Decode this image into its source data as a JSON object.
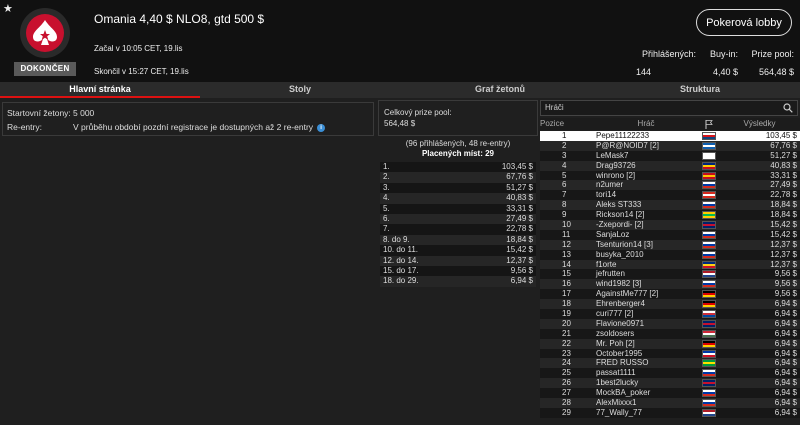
{
  "header": {
    "title": "Omania 4,40 $ NLO8, gtd 500 $",
    "started": "Začal v 10:05 CET, 19.lis",
    "ended": "Skončil v 15:27 CET, 19.lis",
    "status_badge": "DOKONČEN",
    "lobby_button": "Pokerová lobby",
    "stats": [
      {
        "label": "Přihlášených:",
        "value": "144"
      },
      {
        "label": "Buy-in:",
        "value": "4,40 $"
      },
      {
        "label": "Prize pool:",
        "value": "564,48 $"
      }
    ]
  },
  "tabs": [
    {
      "label": "Hlavní stránka",
      "active": true
    },
    {
      "label": "Stoly",
      "active": false
    },
    {
      "label": "Graf žetonů",
      "active": false
    },
    {
      "label": "Struktura",
      "active": false
    }
  ],
  "info": {
    "stack_label": "Startovní žetony:",
    "stack_value": "5 000",
    "reentry_label": "Re-entry:",
    "reentry_value": "V průběhu období pozdní registrace je dostupných až 2 re-entry"
  },
  "prize": {
    "pool_label": "Celkový prize pool:",
    "pool_value": "564,48 $",
    "entries": "(96 přihlášených, 48 re-entry)",
    "paid": "Placených míst: 29",
    "rows": [
      {
        "place": "1.",
        "amount": "103,45 $"
      },
      {
        "place": "2.",
        "amount": "67,76 $"
      },
      {
        "place": "3.",
        "amount": "51,27 $"
      },
      {
        "place": "4.",
        "amount": "40,83 $"
      },
      {
        "place": "5.",
        "amount": "33,31 $"
      },
      {
        "place": "6.",
        "amount": "27,49 $"
      },
      {
        "place": "7.",
        "amount": "22,78 $"
      },
      {
        "place": "8. do 9.",
        "amount": "18,84 $"
      },
      {
        "place": "10. do 11.",
        "amount": "15,42 $"
      },
      {
        "place": "12. do 14.",
        "amount": "12,37 $"
      },
      {
        "place": "15. do 17.",
        "amount": "9,56 $"
      },
      {
        "place": "18. do 29.",
        "amount": "6,94 $"
      }
    ]
  },
  "players": {
    "search_placeholder": "Hráči",
    "columns": {
      "pos": "Pozice",
      "player": "Hráč",
      "win": "Výsledky"
    },
    "rows": [
      {
        "pos": "1",
        "name": "Pepe11122233",
        "win": "103,45 $",
        "flag": [
          "#fff",
          "#d7141a",
          "#11457e"
        ]
      },
      {
        "pos": "2",
        "name": "P@R@NOID7 [2]",
        "win": "67,76 $",
        "flag": [
          "#0d5eaf",
          "#fff",
          "#0d5eaf"
        ]
      },
      {
        "pos": "3",
        "name": "LeMask7",
        "win": "51,27 $",
        "flag": [
          "#fff",
          "#fff",
          "#fff"
        ]
      },
      {
        "pos": "4",
        "name": "Drag93726",
        "win": "40,83 $",
        "flag": [
          "#00247d",
          "#ffcc00",
          "#c60b1e"
        ]
      },
      {
        "pos": "5",
        "name": "winrono [2]",
        "win": "33,31 $",
        "flag": [
          "#c60b1e",
          "#ffc400",
          "#c60b1e"
        ]
      },
      {
        "pos": "6",
        "name": "n2umer",
        "win": "27,49 $",
        "flag": [
          "#fff",
          "#0039a6",
          "#d52b1e"
        ]
      },
      {
        "pos": "7",
        "name": "tori14",
        "win": "22,78 $",
        "flag": [
          "#d52b1e",
          "#fff",
          "#d52b1e"
        ]
      },
      {
        "pos": "8",
        "name": "Aleks ST333",
        "win": "18,84 $",
        "flag": [
          "#fff",
          "#0039a6",
          "#d52b1e"
        ]
      },
      {
        "pos": "9",
        "name": "Rickson14 [2]",
        "win": "18,84 $",
        "flag": [
          "#ffcc00",
          "#0b5",
          "#ffcc00"
        ]
      },
      {
        "pos": "10",
        "name": "-Zxepordi- [2]",
        "win": "15,42 $",
        "flag": [
          "#012169",
          "#c8102e",
          "#012169"
        ]
      },
      {
        "pos": "11",
        "name": "SanjaLoz",
        "win": "15,42 $",
        "flag": [
          "#fff",
          "#0039a6",
          "#d52b1e"
        ]
      },
      {
        "pos": "12",
        "name": "Tsenturion14 [3]",
        "win": "12,37 $",
        "flag": [
          "#fff",
          "#0039a6",
          "#d52b1e"
        ]
      },
      {
        "pos": "13",
        "name": "busyka_2010",
        "win": "12,37 $",
        "flag": [
          "#fff",
          "#0039a6",
          "#d52b1e"
        ]
      },
      {
        "pos": "14",
        "name": "f1orte",
        "win": "12,37 $",
        "flag": [
          "#002b7f",
          "#fcd116",
          "#ce1126"
        ]
      },
      {
        "pos": "15",
        "name": "jefrutten",
        "win": "9,56 $",
        "flag": [
          "#ae1c28",
          "#fff",
          "#21468b"
        ]
      },
      {
        "pos": "16",
        "name": "wind1982 [3]",
        "win": "9,56 $",
        "flag": [
          "#fff",
          "#0039a6",
          "#d52b1e"
        ]
      },
      {
        "pos": "17",
        "name": "AgainstMe777 [2]",
        "win": "9,56 $",
        "flag": [
          "#000",
          "#dd0000",
          "#ffce00"
        ]
      },
      {
        "pos": "18",
        "name": "Ehrenberger4",
        "win": "6,94 $",
        "flag": [
          "#000",
          "#dd0000",
          "#ffce00"
        ]
      },
      {
        "pos": "19",
        "name": "curi777 [2]",
        "win": "6,94 $",
        "flag": [
          "#fff",
          "#cd2e3a",
          "#0047a0"
        ]
      },
      {
        "pos": "20",
        "name": "Flavione0971",
        "win": "6,94 $",
        "flag": [
          "#012169",
          "#c8102e",
          "#012169"
        ]
      },
      {
        "pos": "21",
        "name": "zsoldosers",
        "win": "6,94 $",
        "flag": [
          "#ce2939",
          "#fff",
          "#477050"
        ]
      },
      {
        "pos": "22",
        "name": "Mr. Poh [2]",
        "win": "6,94 $",
        "flag": [
          "#000",
          "#dd0000",
          "#ffce00"
        ]
      },
      {
        "pos": "23",
        "name": "October1995",
        "win": "6,94 $",
        "flag": [
          "#0038a8",
          "#fff",
          "#ce1126"
        ]
      },
      {
        "pos": "24",
        "name": "FRED RUSSO",
        "win": "6,94 $",
        "flag": [
          "#009c3b",
          "#ffdf00",
          "#009c3b"
        ]
      },
      {
        "pos": "25",
        "name": "passat1111",
        "win": "6,94 $",
        "flag": [
          "#fff",
          "#0039a6",
          "#d52b1e"
        ]
      },
      {
        "pos": "26",
        "name": "1best2lucky",
        "win": "6,94 $",
        "flag": [
          "#012169",
          "#c8102e",
          "#012169"
        ]
      },
      {
        "pos": "27",
        "name": "MockBA_poker",
        "win": "6,94 $",
        "flag": [
          "#fff",
          "#0039a6",
          "#d52b1e"
        ]
      },
      {
        "pos": "28",
        "name": "AlexMixxx1",
        "win": "6,94 $",
        "flag": [
          "#fff",
          "#0039a6",
          "#d52b1e"
        ]
      },
      {
        "pos": "29",
        "name": "77_Wally_77",
        "win": "6,94 $",
        "flag": [
          "#ae1c28",
          "#fff",
          "#21468b"
        ]
      }
    ]
  },
  "colors": {
    "accent": "#d11111",
    "background": "#1f1f1f",
    "header": "#111111"
  }
}
